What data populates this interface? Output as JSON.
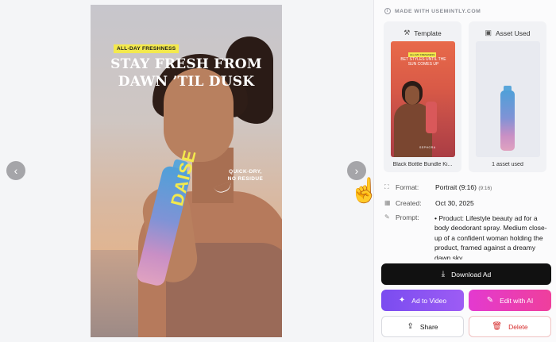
{
  "preview": {
    "badge": "ALL-DAY FRESHNESS",
    "headline_line1": "STAY FRESH FROM",
    "headline_line2": "DAWN ’TIL DUSK",
    "tag_line1": "QUICK-DRY,",
    "tag_line2": "NO RESIDUE",
    "product_brand": "DAISE",
    "prev_icon": "chevron-left-icon",
    "next_icon": "chevron-right-icon"
  },
  "panel": {
    "made_with": "MADE WITH USEMINTLY.COM",
    "template": {
      "title": "Template",
      "caption": "Black Bottle Bundle Ki...",
      "mini_badge": "ALL-DAY FRESHNESS",
      "mini_text": "BET STYLES UNTIL THE SUN COMES UP",
      "mini_brand": "SEPHORA"
    },
    "asset": {
      "title": "Asset Used",
      "caption": "1 asset used"
    },
    "format": {
      "label": "Format:",
      "value": "Portrait (9:16)",
      "sub": "(9:16)"
    },
    "created": {
      "label": "Created:",
      "value": "Oct 30, 2025"
    },
    "prompt": {
      "label": "Prompt:",
      "value": "• Product: Lifestyle beauty ad for a body deodorant spray. Medium close-up of a confident woman holding the product, framed against a dreamy dawn sky"
    }
  },
  "actions": {
    "download": "Download Ad",
    "add_to_video": "Ad to Video",
    "edit_with_ai": "Edit with AI",
    "share": "Share",
    "delete": "Delete"
  },
  "colors": {
    "accent_yellow": "#f3e94d",
    "download_bg": "#111111",
    "video_purple": "#8a52f2",
    "edit_pink": "#e83cb5",
    "delete_red": "#d62e2e"
  }
}
